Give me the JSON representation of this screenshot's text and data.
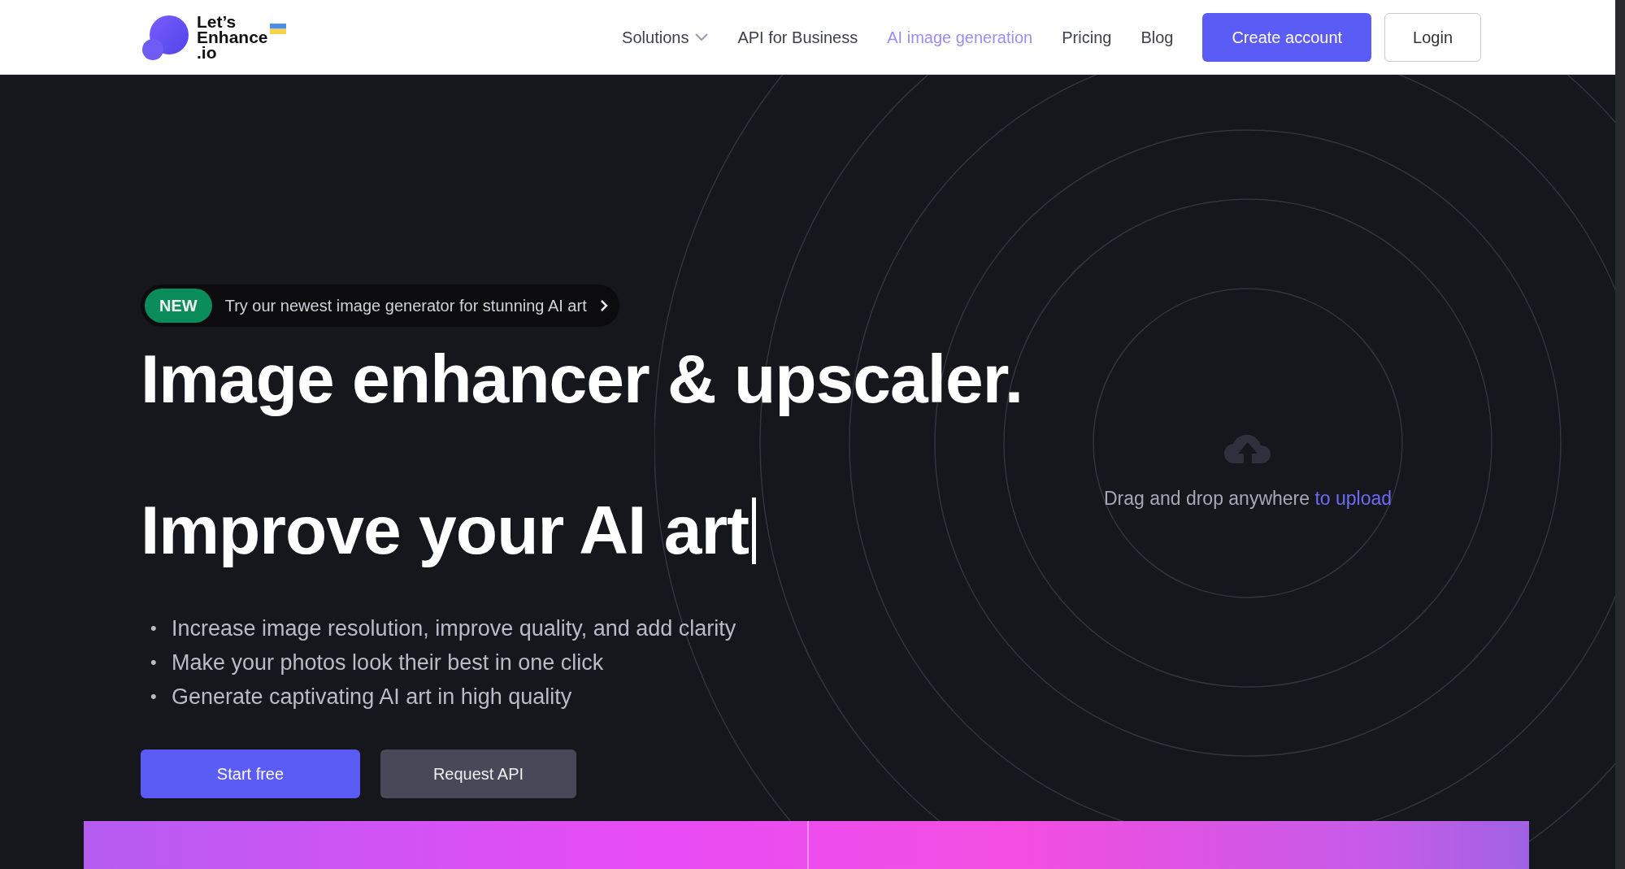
{
  "header": {
    "logo_lines": [
      "Let’s",
      "Enhance",
      ".io"
    ],
    "nav": [
      {
        "label": "Solutions",
        "kind": "dropdown",
        "selected": false
      },
      {
        "label": "API for Business",
        "kind": "link",
        "selected": false
      },
      {
        "label": "AI image generation",
        "kind": "link",
        "selected": true
      },
      {
        "label": "Pricing",
        "kind": "link",
        "selected": false
      },
      {
        "label": "Blog",
        "kind": "link",
        "selected": false
      }
    ],
    "buttons": [
      {
        "label": "Create account",
        "kind": "primary"
      },
      {
        "label": "Login",
        "kind": "outline"
      }
    ]
  },
  "hero": {
    "announcement": {
      "badge": "NEW",
      "text": "Try our newest image generator for stunning AI art"
    },
    "title": "Image enhancer & upscaler.",
    "subtitle": "Improve your AI art",
    "bullets": [
      {
        "marker": "•",
        "text": "Increase image resolution, improve quality, and add clarity"
      },
      {
        "marker": "•",
        "text": "Make your photos look their best in one click"
      },
      {
        "marker": "•",
        "text": "Generate captivating AI art in high quality"
      }
    ],
    "buttons": [
      {
        "label": "Start free",
        "kind": "primary"
      },
      {
        "label": "Request API",
        "kind": "secondary"
      }
    ]
  },
  "upload": {
    "text": "Drag and drop anywhere ",
    "link": "to upload"
  }
}
